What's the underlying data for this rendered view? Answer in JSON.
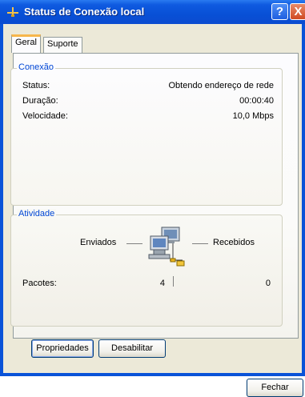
{
  "window": {
    "title": "Status de Conexão local"
  },
  "title_buttons": {
    "help": "?",
    "close": "X"
  },
  "tabs": [
    {
      "label": "Geral"
    },
    {
      "label": "Suporte"
    }
  ],
  "conexao": {
    "title": "Conexão",
    "status_label": "Status:",
    "status_value": "Obtendo endereço de rede",
    "duracao_label": "Duração:",
    "duracao_value": "00:00:40",
    "velocidade_label": "Velocidade:",
    "velocidade_value": "10,0 Mbps"
  },
  "atividade": {
    "title": "Atividade",
    "enviados_label": "Enviados",
    "recebidos_label": "Recebidos",
    "pacotes_label": "Pacotes:",
    "pacotes_enviados": "4",
    "pacotes_recebidos": "0"
  },
  "buttons": {
    "propriedades": "Propriedades",
    "desabilitar": "Desabilitar",
    "fechar": "Fechar"
  }
}
